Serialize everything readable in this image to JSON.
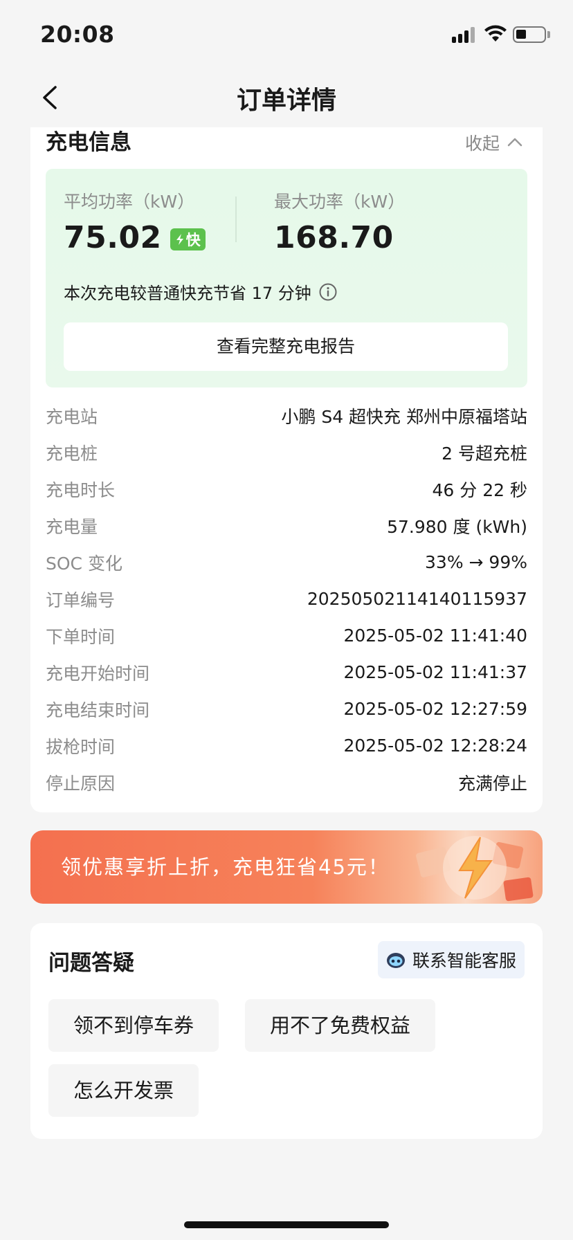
{
  "status_bar": {
    "time": "20:08"
  },
  "nav": {
    "title": "订单详情"
  },
  "charge_info": {
    "title": "充电信息",
    "collapse_label": "收起",
    "avg_power_label": "平均功率（kW）",
    "avg_power_value": "75.02",
    "fast_badge": "快",
    "max_power_label": "最大功率（kW）",
    "max_power_value": "168.70",
    "saving_text": "本次充电较普通快充节省 17 分钟",
    "report_button": "查看完整充电报告",
    "details": [
      {
        "label": "充电站",
        "value": "小鹏 S4 超快充 郑州中原福塔站"
      },
      {
        "label": "充电桩",
        "value": "2 号超充桩"
      },
      {
        "label": "充电时长",
        "value": "46 分 22 秒"
      },
      {
        "label": "充电量",
        "value": "57.980 度 (kWh)"
      },
      {
        "label": "SOC 变化",
        "value": "33% → 99%"
      },
      {
        "label": "订单编号",
        "value": "2025050211414011 5937"
      },
      {
        "label": "下单时间",
        "value": "2025-05-02 11:41:40"
      },
      {
        "label": "充电开始时间",
        "value": "2025-05-02 11:41:37"
      },
      {
        "label": "充电结束时间",
        "value": "2025-05-02 12:27:59"
      },
      {
        "label": "拔枪时间",
        "value": "2025-05-02 12:28:24"
      },
      {
        "label": "停止原因",
        "value": "充满停止"
      }
    ]
  },
  "promo": {
    "text": "领优惠享折上折，充电狂省45元！"
  },
  "faq": {
    "title": "问题答疑",
    "service_button": "联系智能客服",
    "chips": [
      "领不到停车券",
      "用不了免费权益",
      "怎么开发票"
    ]
  },
  "colors": {
    "accent_green": "#5cc14d",
    "promo_orange": "#f4704f",
    "power_box_bg": "#e6f9ea"
  }
}
